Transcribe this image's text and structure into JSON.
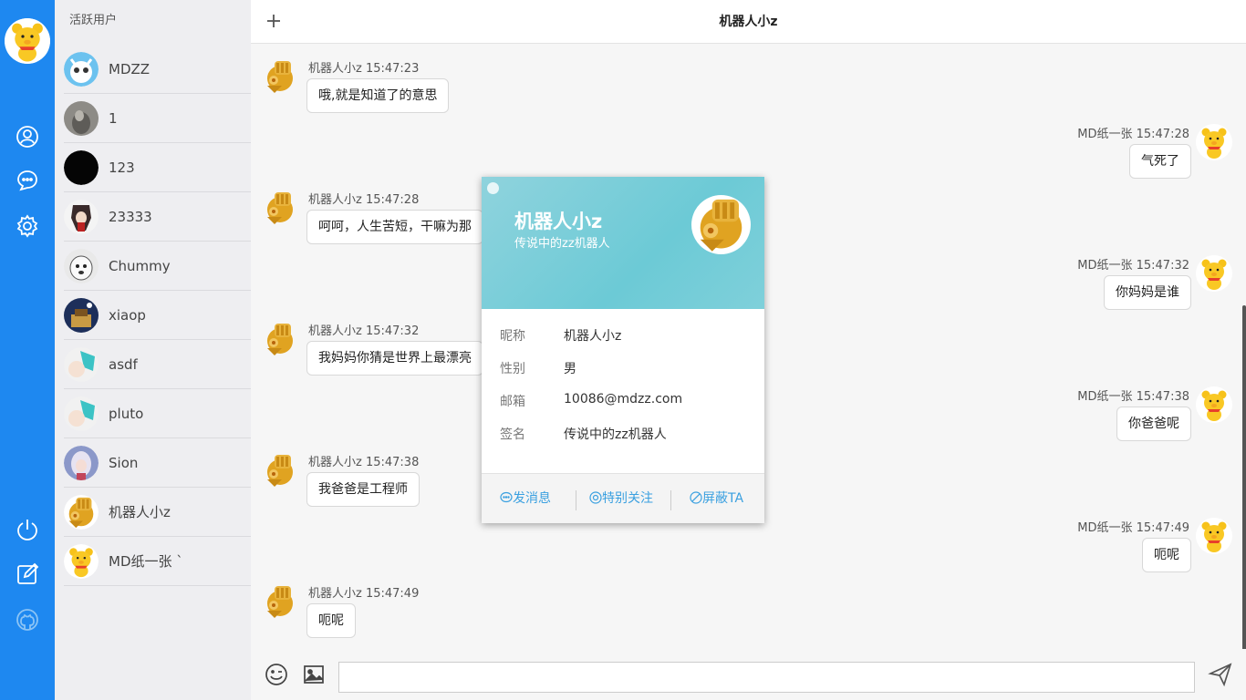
{
  "sidebar": {
    "icons": [
      "user-icon",
      "chat-icon",
      "settings-icon",
      "power-icon",
      "edit-icon",
      "github-icon"
    ]
  },
  "userlist": {
    "header": "活跃用户",
    "users": [
      {
        "name": "MDZZ"
      },
      {
        "name": "1"
      },
      {
        "name": "123"
      },
      {
        "name": "23333"
      },
      {
        "name": "Chummy"
      },
      {
        "name": "xiaop"
      },
      {
        "name": "asdf"
      },
      {
        "name": "pluto"
      },
      {
        "name": "Sion"
      },
      {
        "name": "机器人小z"
      },
      {
        "name": "MD纸一张 `"
      }
    ]
  },
  "chat": {
    "title": "机器人小z",
    "messages": [
      {
        "side": "left",
        "meta": "机器人小z 15:47:23",
        "text": "哦,就是知道了的意思"
      },
      {
        "side": "right",
        "meta": "MD纸一张 15:47:28",
        "text": "气死了"
      },
      {
        "side": "left",
        "meta": "机器人小z 15:47:28",
        "text": "呵呵，人生苦短，干嘛为那"
      },
      {
        "side": "right",
        "meta": "MD纸一张 15:47:32",
        "text": "你妈妈是谁"
      },
      {
        "side": "left",
        "meta": "机器人小z 15:47:32",
        "text": "我妈妈你猜是世界上最漂亮"
      },
      {
        "side": "right",
        "meta": "MD纸一张 15:47:38",
        "text": "你爸爸呢"
      },
      {
        "side": "left",
        "meta": "机器人小z 15:47:38",
        "text": "我爸爸是工程师"
      },
      {
        "side": "right",
        "meta": "MD纸一张 15:47:49",
        "text": "呃呢"
      },
      {
        "side": "left",
        "meta": "机器人小z 15:47:49",
        "text": "呃呢"
      }
    ],
    "input_value": ""
  },
  "card": {
    "name": "机器人小z",
    "signature": "传说中的zz机器人",
    "fields": [
      {
        "key": "昵称",
        "value": "机器人小z"
      },
      {
        "key": "性别",
        "value": "男"
      },
      {
        "key": "邮箱",
        "value": "10086@mdzz.com"
      },
      {
        "key": "签名",
        "value": "传说中的zz机器人"
      }
    ],
    "actions": {
      "message": "发消息",
      "follow": "特别关注",
      "block": "屏蔽TA"
    }
  },
  "colors": {
    "rail": "#1e88f0",
    "card_banner": "#6ccad6",
    "action_text": "#3aa0e0"
  }
}
